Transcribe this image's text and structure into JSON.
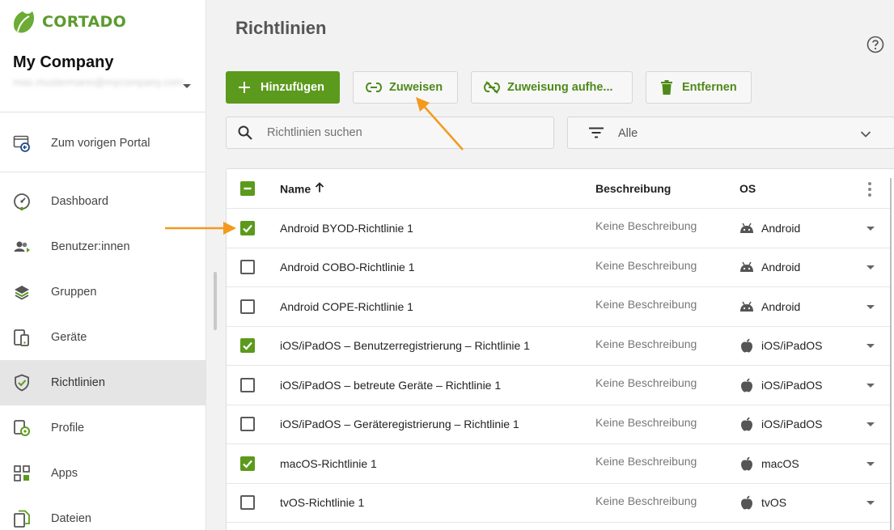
{
  "brand": {
    "name": "CORTADO",
    "accent": "#5b9a1c"
  },
  "account": {
    "company": "My Company",
    "email": "max.mustermann@mycompany.com"
  },
  "sidebar": {
    "back_item": {
      "label": "Zum vorigen Portal",
      "icon": "portal-back-icon"
    },
    "items": [
      {
        "label": "Dashboard",
        "icon": "speedometer-icon"
      },
      {
        "label": "Benutzer:innen",
        "icon": "users-icon"
      },
      {
        "label": "Gruppen",
        "icon": "layers-icon"
      },
      {
        "label": "Geräte",
        "icon": "devices-icon"
      },
      {
        "label": "Richtlinien",
        "icon": "shield-check-icon",
        "active": true
      },
      {
        "label": "Profile",
        "icon": "profile-gear-icon"
      },
      {
        "label": "Apps",
        "icon": "apps-grid-icon"
      },
      {
        "label": "Dateien",
        "icon": "files-icon"
      }
    ]
  },
  "main": {
    "title": "Richtlinien",
    "toolbar": {
      "add_label": "Hinzufügen",
      "assign_label": "Zuweisen",
      "unassign_label": "Zuweisung aufhe...",
      "remove_label": "Entfernen"
    },
    "search": {
      "placeholder": "Richtlinien suchen",
      "value": ""
    },
    "filter": {
      "selected": "Alle"
    },
    "table": {
      "columns": {
        "name": "Name",
        "description": "Beschreibung",
        "os": "OS"
      },
      "sort": {
        "column": "Name",
        "direction": "ascending"
      },
      "rows": [
        {
          "name": "Android BYOD-Richtlinie 1",
          "description": "Keine Beschreibung",
          "os": "Android",
          "os_icon": "android-icon",
          "checked": true
        },
        {
          "name": "Android COBO-Richtlinie 1",
          "description": "Keine Beschreibung",
          "os": "Android",
          "os_icon": "android-icon",
          "checked": false
        },
        {
          "name": "Android COPE-Richtlinie 1",
          "description": "Keine Beschreibung",
          "os": "Android",
          "os_icon": "android-icon",
          "checked": false
        },
        {
          "name": "iOS/iPadOS – Benutzerregistrierung – Richtlinie 1",
          "description": "Keine Beschreibung",
          "os": "iOS/iPadOS",
          "os_icon": "apple-icon",
          "checked": true
        },
        {
          "name": "iOS/iPadOS – betreute Geräte – Richtlinie 1",
          "description": "Keine Beschreibung",
          "os": "iOS/iPadOS",
          "os_icon": "apple-icon",
          "checked": false
        },
        {
          "name": "iOS/iPadOS – Geräteregistrierung – Richtlinie 1",
          "description": "Keine Beschreibung",
          "os": "iOS/iPadOS",
          "os_icon": "apple-icon",
          "checked": false
        },
        {
          "name": "macOS-Richtlinie 1",
          "description": "Keine Beschreibung",
          "os": "macOS",
          "os_icon": "apple-icon",
          "checked": true
        },
        {
          "name": "tvOS-Richtlinie 1",
          "description": "Keine Beschreibung",
          "os": "tvOS",
          "os_icon": "apple-icon",
          "checked": false
        }
      ]
    }
  },
  "annotations": {
    "arrow_color": "#f39a1e"
  }
}
